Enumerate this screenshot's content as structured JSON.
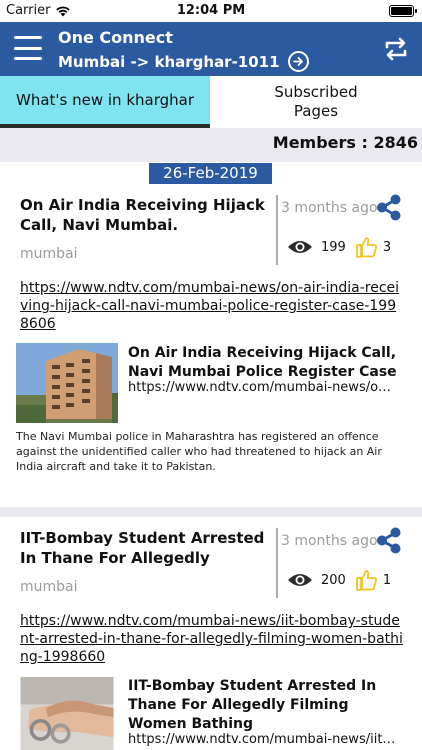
{
  "status_bar": {
    "carrier": "Carrier",
    "time": "12:04 PM"
  },
  "header": {
    "title": "One Connect",
    "location": "Mumbai -> kharghar-1011",
    "icons": {
      "menu": "hamburger-menu-icon",
      "location_arrow": "arrow-right-circle-icon",
      "refresh": "sync-icon"
    }
  },
  "tabs": [
    {
      "label": "What's new in kharghar",
      "active": true
    },
    {
      "label": "Subscribed Pages",
      "active": false
    }
  ],
  "members": "Members : 2846",
  "date_label": "26-Feb-2019",
  "colors": {
    "header_bg": "#2c5aa0",
    "active_tab": "#7fe3f0",
    "band": "#e9e9ef",
    "thumb": "#f0c419"
  },
  "posts": [
    {
      "title": "On Air India Receiving Hijack Call, Navi Mumbai.",
      "source": "mumbai",
      "time_ago": "3 months ago",
      "views": "199",
      "likes": "3",
      "link": "https://www.ndtv.com/mumbai-news/on-air-india-receiving-hijack-call-navi-mumbai-police-register-case-1998606",
      "preview": {
        "title": "On Air India Receiving Hijack Call, Navi Mumbai Police Register Case",
        "url": "https://www.ndtv.com/mumbai-news/on-air-india-receiving-hijack-call",
        "description": "The Navi Mumbai police in Maharashtra has registered an offence against the unidentified caller who had threatened to hijack an Air India aircraft and take it to Pakistan."
      }
    },
    {
      "title": "IIT-Bombay Student Arrested In Thane For Allegedly",
      "source": "mumbai",
      "time_ago": "3 months ago",
      "views": "200",
      "likes": "1",
      "link": "https://www.ndtv.com/mumbai-news/iit-bombay-student-arrested-in-thane-for-allegedly-filming-women-bathing-1998660",
      "preview": {
        "title": "IIT-Bombay Student Arrested In Thane For Allegedly Filming Women Bathing",
        "url": "https://www.ndtv.com/mumbai-news/iit-bombay-student-arrested"
      }
    }
  ]
}
